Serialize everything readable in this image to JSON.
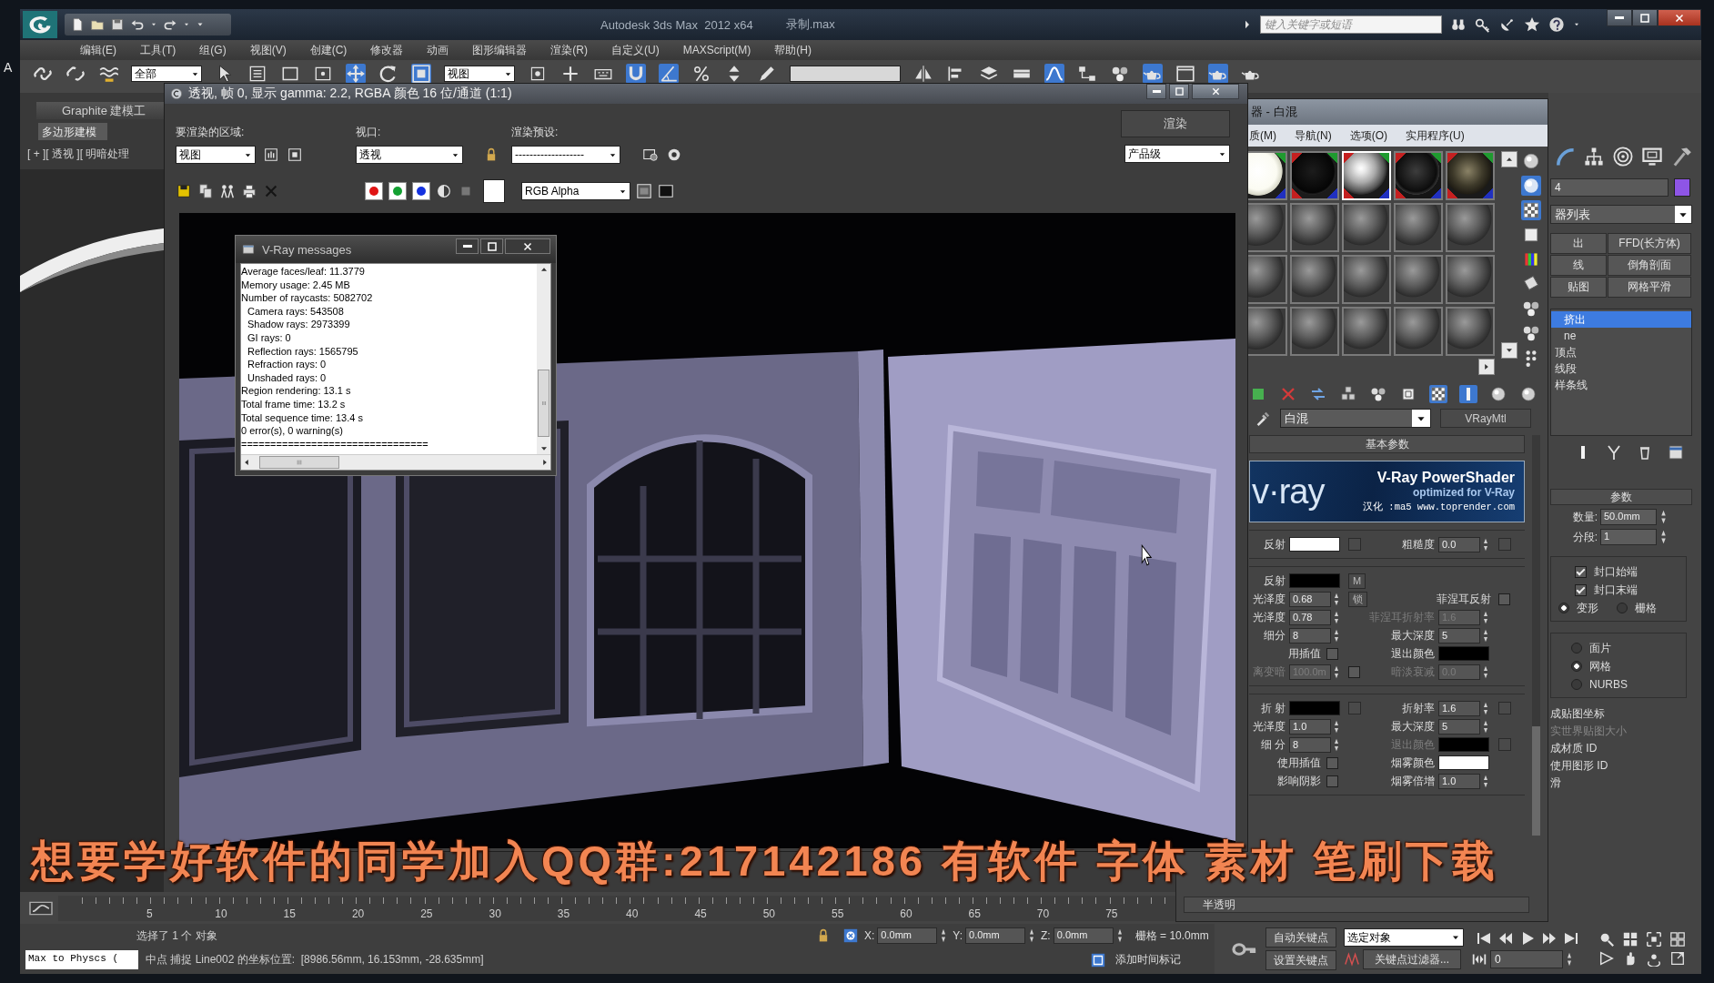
{
  "desktop": {
    "edge_text": "A"
  },
  "window": {
    "title": "Autodesk 3ds Max  2012 x64",
    "file": "录制.max",
    "search": {
      "placeholder": "键入关键字或短语"
    }
  },
  "menu": [
    "编辑(E)",
    "工具(T)",
    "组(G)",
    "视图(V)",
    "创建(C)",
    "修改器",
    "动画",
    "图形编辑器",
    "渲染(R)",
    "自定义(U)",
    "MAXScript(M)",
    "帮助(H)"
  ],
  "toolbar": [
    {
      "kind": "link",
      "on": false
    },
    {
      "kind": "unlink",
      "on": false
    },
    {
      "kind": "bind",
      "on": false
    },
    {
      "kind": "dropdown",
      "value": "全部"
    },
    {
      "kind": "arrow",
      "on": false
    },
    {
      "kind": "list",
      "on": false
    },
    {
      "kind": "rect",
      "on": false
    },
    {
      "kind": "window",
      "on": false
    },
    {
      "kind": "move",
      "on": true
    },
    {
      "kind": "rotate",
      "on": false
    },
    {
      "kind": "scale",
      "on": true
    },
    {
      "kind": "dropdown",
      "value": "视图"
    },
    {
      "kind": "pivot",
      "on": false
    },
    {
      "kind": "manip",
      "on": false
    },
    {
      "kind": "keyboard",
      "on": false
    },
    {
      "kind": "snap",
      "on": true
    },
    {
      "kind": "angle",
      "on": true
    },
    {
      "kind": "percent",
      "on": false
    },
    {
      "kind": "spinner",
      "on": false
    },
    {
      "kind": "edit",
      "on": false
    },
    {
      "kind": "field"
    },
    {
      "kind": "mirror",
      "on": false
    },
    {
      "kind": "align",
      "on": false
    },
    {
      "kind": "layers",
      "on": false
    },
    {
      "kind": "strip",
      "on": false
    },
    {
      "kind": "curve",
      "on": true
    },
    {
      "kind": "graph",
      "on": false
    },
    {
      "kind": "spheres",
      "on": false
    },
    {
      "kind": "teapot",
      "on": true
    },
    {
      "kind": "frame",
      "on": false
    },
    {
      "kind": "teapot",
      "on": true
    },
    {
      "kind": "teapot",
      "on": false
    }
  ],
  "ribbon": {
    "tab": "Graphite 建模工",
    "panel": "多边形建模"
  },
  "viewport": {
    "label": "[ + ][ 透视 ][ 明暗处理"
  },
  "render_window": {
    "title": "透视, 帧 0, 显示 gamma: 2.2, RGBA 颜色 16 位/通道 (1:1)",
    "area": {
      "label": "要渲染的区域:",
      "value": "视图"
    },
    "viewport": {
      "label": "视口:",
      "value": "透视"
    },
    "preset": {
      "label": "渲染预设:",
      "value": "-------------------"
    },
    "render_button": "渲染",
    "quality": "产品级",
    "channels": [
      {
        "color": "#e01414",
        "on": true
      },
      {
        "color": "#13a032",
        "on": true
      },
      {
        "color": "#1432e0",
        "on": true
      }
    ],
    "background": {
      "color": "#ffffff"
    },
    "display": "RGB Alpha"
  },
  "vray_messages": {
    "title": "V-Ray messages",
    "lines": [
      {
        "text": "Average faces/leaf: 11.3779"
      },
      {
        "text": "Memory usage: 2.45 MB"
      },
      {
        "text": "Number of raycasts: 5082702",
        "children": [
          {
            "text": "Camera rays: 543508"
          },
          {
            "text": "Shadow rays: 2973399"
          },
          {
            "text": "GI rays: 0"
          },
          {
            "text": "Reflection rays: 1565795"
          },
          {
            "text": "Refraction rays: 0"
          },
          {
            "text": "Unshaded rays: 0"
          }
        ]
      },
      {
        "text": "Region rendering: 13.1 s"
      },
      {
        "text": "Total frame time: 13.2 s"
      },
      {
        "text": "Total sequence time: 13.4 s"
      },
      {
        "text": "0 error(s), 0 warning(s)"
      },
      {
        "text": "================================"
      }
    ]
  },
  "material_editor": {
    "title": "器 - 白混",
    "menu": [
      "质(M)",
      "导航(N)",
      "选项(O)",
      "实用程序(U)"
    ],
    "slots": [
      {
        "kind": "white",
        "in_scene": true,
        "selected": false
      },
      {
        "kind": "black",
        "in_scene": true,
        "selected": false
      },
      {
        "kind": "chrome",
        "in_scene": true,
        "selected": true
      },
      {
        "kind": "dark",
        "in_scene": true,
        "selected": false
      },
      {
        "kind": "texture",
        "in_scene": true,
        "selected": false
      },
      {
        "kind": "gray",
        "in_scene": false,
        "selected": false
      },
      {
        "kind": "gray",
        "in_scene": false,
        "selected": false
      },
      {
        "kind": "gray",
        "in_scene": false,
        "selected": false
      },
      {
        "kind": "gray",
        "in_scene": false,
        "selected": false
      },
      {
        "kind": "gray",
        "in_scene": false,
        "selected": false
      },
      {
        "kind": "gray",
        "in_scene": false,
        "selected": false
      },
      {
        "kind": "gray",
        "in_scene": false,
        "selected": false
      },
      {
        "kind": "gray",
        "in_scene": false,
        "selected": false
      },
      {
        "kind": "gray",
        "in_scene": false,
        "selected": false
      },
      {
        "kind": "gray",
        "in_scene": false,
        "selected": false
      },
      {
        "kind": "gray",
        "in_scene": false,
        "selected": false
      },
      {
        "kind": "gray",
        "in_scene": false,
        "selected": false
      },
      {
        "kind": "gray",
        "in_scene": false,
        "selected": false
      },
      {
        "kind": "gray",
        "in_scene": false,
        "selected": false
      },
      {
        "kind": "gray",
        "in_scene": false,
        "selected": false
      }
    ],
    "side_toolbar": [
      {
        "kind": "sphere",
        "on": false
      },
      {
        "kind": "backlight",
        "on": true
      },
      {
        "kind": "checker",
        "on": true
      },
      {
        "kind": "square",
        "on": false
      },
      {
        "kind": "bars",
        "on": false
      },
      {
        "kind": "film",
        "on": false
      },
      {
        "kind": "spheres",
        "on": false
      },
      {
        "kind": "spheres",
        "on": false
      },
      {
        "kind": "dots",
        "on": false
      }
    ],
    "bottom_toolbar": [
      {
        "kind": "assign",
        "on": false
      },
      {
        "kind": "delete",
        "on": false
      },
      {
        "kind": "swap",
        "on": false
      },
      {
        "kind": "cubes",
        "on": false
      },
      {
        "kind": "spheres",
        "on": false
      },
      {
        "kind": "map",
        "on": false
      },
      {
        "kind": "checker",
        "on": true
      },
      {
        "kind": "bar",
        "on": true
      },
      {
        "kind": "sphere",
        "on": false
      },
      {
        "kind": "sphere",
        "on": false
      }
    ],
    "material_name": "白混",
    "material_type": "VRayMtl",
    "rollout": "基本参数",
    "banner": {
      "logo": "v·ray",
      "title": "V-Ray PowerShader",
      "subtitle": "optimized for V-Ray",
      "credit": "汉化 :ma5 www.toprender.com"
    },
    "sections": [
      {
        "rows": [
          {
            "left": {
              "kind": "swatch",
              "label": "反射",
              "color": "#ffffff",
              "disabled": false,
              "map_slot": true
            },
            "right": {
              "kind": "spinner",
              "label": "粗糙度",
              "value": "0.0",
              "disabled": false,
              "map_slot": true
            }
          }
        ]
      },
      {
        "rows": [
          {
            "left": {
              "kind": "swatch",
              "label": "反射",
              "color": "#000000",
              "disabled": false
            },
            "mid": {
              "kind": "button",
              "label": "M"
            }
          },
          {
            "left": {
              "kind": "spinner",
              "label": "光泽度",
              "value": "0.68",
              "disabled": false
            },
            "mid": {
              "kind": "button",
              "label": "锁"
            },
            "right": {
              "kind": "check",
              "label": "菲涅耳反射",
              "checked": false,
              "disabled": false
            }
          },
          {
            "left": {
              "kind": "spinner",
              "label": "光泽度",
              "value": "0.78",
              "disabled": false
            },
            "right": {
              "kind": "spinner",
              "label": "菲涅耳折射率",
              "value": "1.6",
              "disabled": true
            }
          },
          {
            "left": {
              "kind": "spinner",
              "label": "细分",
              "value": "8",
              "disabled": false
            },
            "right": {
              "kind": "spinner",
              "label": "最大深度",
              "value": "5",
              "disabled": false
            }
          },
          {
            "left": {
              "kind": "check",
              "label": "用插值",
              "checked": false,
              "disabled": false
            },
            "right": {
              "kind": "swatch",
              "label": "退出颜色",
              "color": "#000000",
              "disabled": false
            }
          },
          {
            "left": {
              "kind": "spinner",
              "label": "离变暗",
              "value": "100.0m",
              "disabled": true
            },
            "mid": {
              "kind": "check",
              "checked": false
            },
            "right": {
              "kind": "spinner",
              "label": "暗淡衰减",
              "value": "0.0",
              "disabled": true
            }
          }
        ]
      },
      {
        "rows": [
          {
            "left": {
              "kind": "swatch",
              "label": "折 射",
              "color": "#000000",
              "disabled": false,
              "map_slot": true
            },
            "right": {
              "kind": "spinner",
              "label": "折射率",
              "value": "1.6",
              "disabled": false,
              "map_slot": true
            }
          },
          {
            "left": {
              "kind": "spinner",
              "label": "光泽度",
              "value": "1.0",
              "disabled": false
            },
            "right": {
              "kind": "spinner",
              "label": "最大深度",
              "value": "5",
              "disabled": false
            }
          },
          {
            "left": {
              "kind": "spinner",
              "label": "细 分",
              "value": "8",
              "disabled": false
            },
            "right": {
              "kind": "swatch",
              "label": "退出颜色",
              "color": "#000000",
              "disabled": true,
              "map_slot": true
            }
          },
          {
            "left": {
              "kind": "check",
              "label": "使用插值",
              "checked": false,
              "disabled": false
            },
            "right": {
              "kind": "swatch",
              "label": "烟雾颜色",
              "color": "#ffffff",
              "disabled": false
            }
          },
          {
            "left": {
              "kind": "check",
              "label": "影响阴影",
              "checked": false,
              "disabled": false
            },
            "right": {
              "kind": "spinner",
              "label": "烟雾倍增",
              "value": "1.0",
              "disabled": false
            }
          }
        ]
      }
    ],
    "bottom_rollout": "半透明"
  },
  "command_panel": {
    "tabs": [
      {
        "kind": "arc"
      },
      {
        "kind": "hierarchy"
      },
      {
        "kind": "target"
      },
      {
        "kind": "monitor"
      },
      {
        "kind": "hammer"
      }
    ],
    "object": {
      "name": "4",
      "color": "#8e55e6"
    },
    "modifier_list": "器列表",
    "modifier_buttons": [
      "出",
      "FFD(长方体)",
      "线",
      "倒角剖面",
      "贴图",
      "网格平滑"
    ],
    "stack": [
      {
        "label": "挤出",
        "selected": true
      },
      {
        "label": "ne",
        "selected": false,
        "children": [
          {
            "label": "顶点",
            "selected": false
          },
          {
            "label": "线段",
            "selected": false
          },
          {
            "label": "样条线",
            "selected": false
          }
        ]
      }
    ],
    "rollout": "参数",
    "amount": {
      "label": "数量:",
      "value": "50.0mm"
    },
    "segments": {
      "label": "分段:",
      "value": "1"
    },
    "caps": [
      {
        "label": "封口始端",
        "checked": true
      },
      {
        "label": "封口末端",
        "checked": true
      }
    ],
    "cap_type": [
      {
        "label": "变形",
        "selected": true
      },
      {
        "label": "栅格",
        "selected": false
      }
    ],
    "output": [
      {
        "label": "面片",
        "selected": false
      },
      {
        "label": "网格",
        "selected": true
      },
      {
        "label": "NURBS",
        "selected": false
      }
    ],
    "options": [
      {
        "label": "成贴图坐标",
        "disabled": false
      },
      {
        "label": "实世界贴图大小",
        "disabled": true
      },
      {
        "label": "成材质 ID",
        "disabled": false
      },
      {
        "label": "使用图形 ID",
        "disabled": false
      },
      {
        "label": "滑",
        "disabled": false
      }
    ]
  },
  "timeline": {
    "ticks": [
      "5",
      "10",
      "15",
      "20",
      "25",
      "30",
      "35",
      "40",
      "45",
      "50",
      "55",
      "60",
      "65",
      "70",
      "75"
    ]
  },
  "status_bar": {
    "selection": "选择了 1 个 对象",
    "coords": [
      {
        "axis": "X:",
        "value": "0.0mm"
      },
      {
        "axis": "Y:",
        "value": "0.0mm"
      },
      {
        "axis": "Z:",
        "value": "0.0mm"
      }
    ],
    "grid": "栅格 = 10.0mm",
    "script": "Max to Physcs (",
    "prompt": "中点 捕捉 Line002 的坐标位置:  [8986.56mm, 16.153mm, -28.635mm]",
    "time_tag": "添加时间标记"
  },
  "animation_controls": {
    "auto_key": "自动关键点",
    "selection_set": "选定对象",
    "set_key": "设置关键点",
    "key_filters": "关键点过滤器...",
    "frame": "0"
  },
  "caption": "想要学好软件的同学加入QQ群:217142186 有软件 字体 素材 笔刷下载"
}
